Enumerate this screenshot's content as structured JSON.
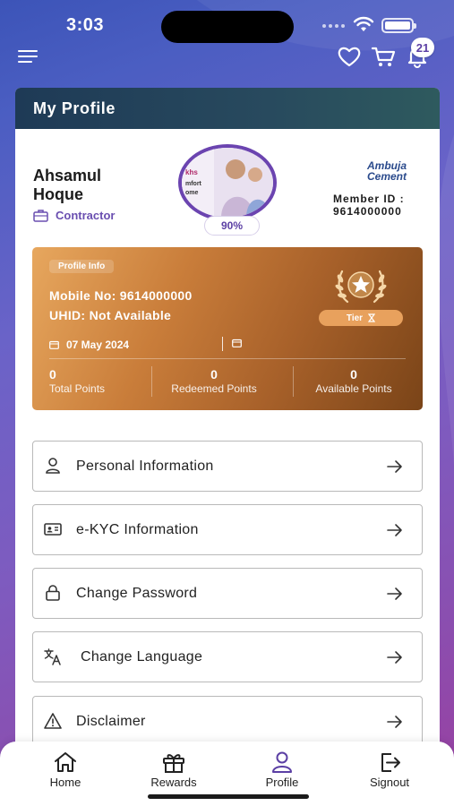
{
  "status_bar": {
    "time": "3:03"
  },
  "header": {
    "notification_count": "21"
  },
  "profile": {
    "title": "My Profile",
    "name_line1": "Ahsamul",
    "name_line2": "Hoque",
    "role": "Contractor",
    "completion": "90%",
    "avatar_text": [
      "khs",
      "mfort",
      "ome"
    ],
    "brand_line1": "Ambuja",
    "brand_line2": "Cement",
    "member_label": "Member ID :",
    "member_id": "9614000000"
  },
  "points": {
    "pill": "Profile Info",
    "mobile": "Mobile No: 9614000000",
    "uhid": "UHID: Not Available",
    "date": "07 May 2024",
    "tier_label": "Tier",
    "stats": [
      {
        "value": "0",
        "label": "Total Points"
      },
      {
        "value": "0",
        "label": "Redeemed Points"
      },
      {
        "value": "0",
        "label": "Available Points"
      }
    ]
  },
  "menu": [
    {
      "label": "Personal Information",
      "icon": "person-icon"
    },
    {
      "label": "e-KYC Information",
      "icon": "id-card-icon"
    },
    {
      "label": "Change Password",
      "icon": "lock-icon"
    },
    {
      "label": "Change Language",
      "icon": "translate-icon"
    },
    {
      "label": "Disclaimer",
      "icon": "warning-icon"
    }
  ],
  "bottom_nav": [
    {
      "label": "Home",
      "icon": "home-icon"
    },
    {
      "label": "Rewards",
      "icon": "gift-icon"
    },
    {
      "label": "Profile",
      "icon": "profile-icon",
      "active": true
    },
    {
      "label": "Signout",
      "icon": "signout-icon"
    }
  ],
  "colors": {
    "accent": "#6b44b0",
    "header": "#1e3a56",
    "points_gold": "#c97d3a"
  }
}
